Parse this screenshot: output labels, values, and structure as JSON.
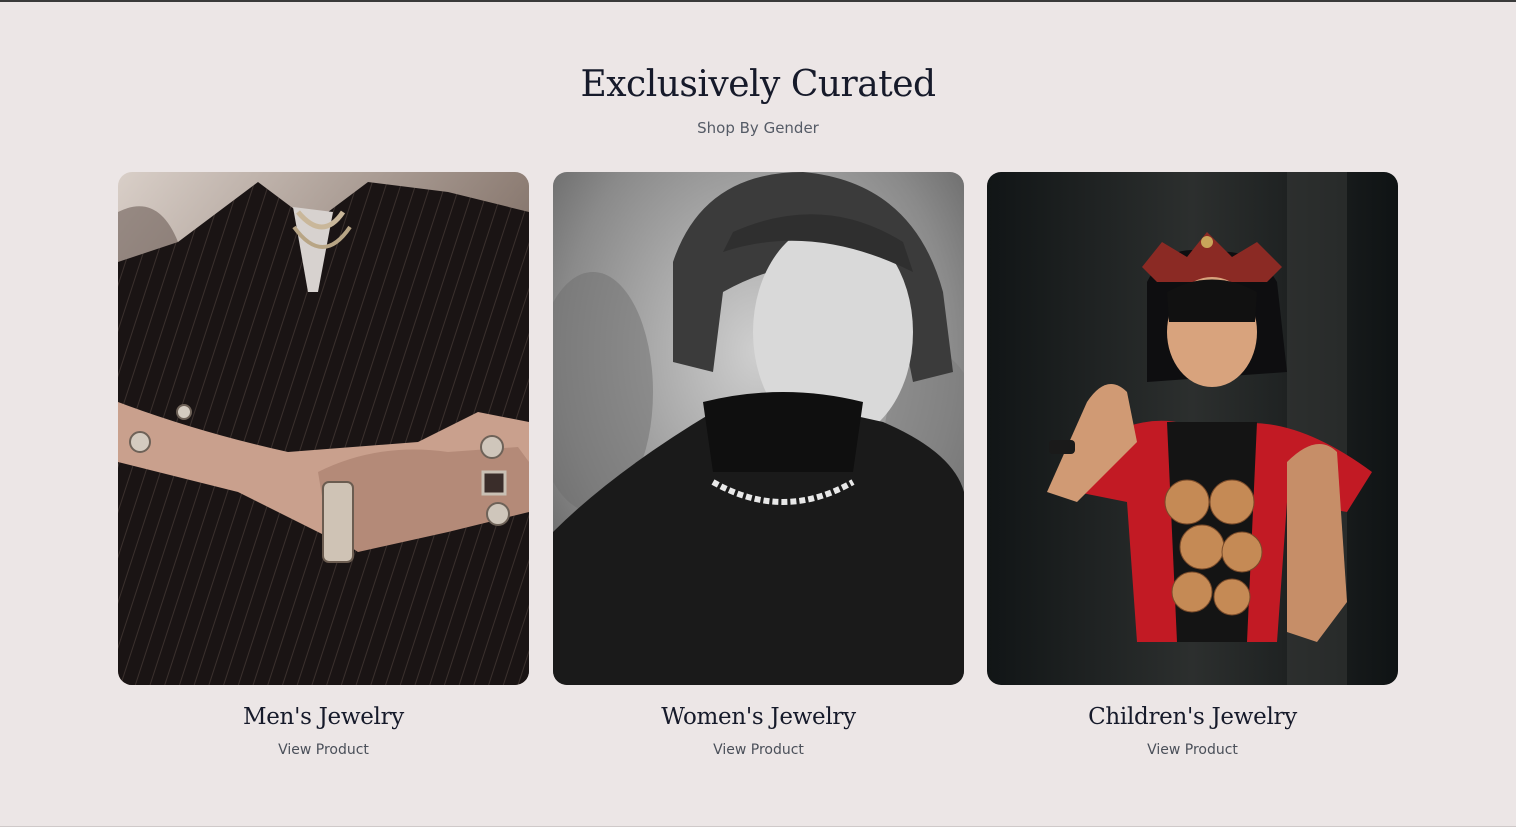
{
  "section": {
    "title": "Exclusively Curated",
    "subtitle": "Shop By Gender"
  },
  "cards": [
    {
      "title": "Men's Jewelry",
      "link_label": "View Product",
      "image": "man-in-pinstripe-suit-with-rings"
    },
    {
      "title": "Women's Jewelry",
      "link_label": "View Product",
      "image": "woman-black-and-white-portrait-chain-necklace"
    },
    {
      "title": "Children's Jewelry",
      "link_label": "View Product",
      "image": "child-in-red-dress-with-crown"
    }
  ],
  "colors": {
    "background": "#ece6e6",
    "heading": "#161a2a",
    "muted_text": "#555b66"
  }
}
